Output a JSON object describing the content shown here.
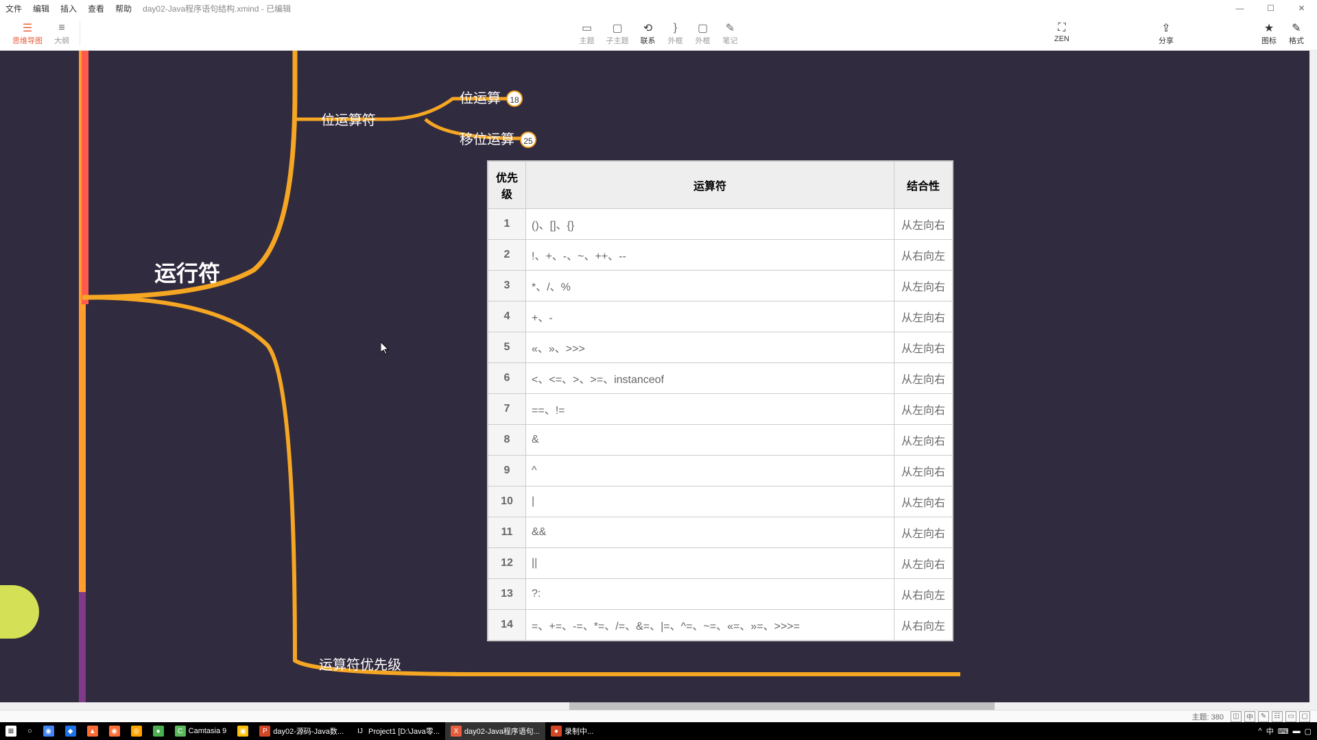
{
  "window": {
    "filename": "day02-Java程序语句结构.xmind - 已编辑",
    "menu": {
      "file": "文件",
      "edit": "编辑",
      "insert": "插入",
      "view": "查看",
      "help": "帮助"
    }
  },
  "toolbar": {
    "mindmap": "思维导图",
    "outline": "大纲",
    "topic": "主题",
    "subtopic": "子主题",
    "relation": "联系",
    "summary": "外框",
    "boundary": "外框",
    "note": "笔记",
    "zen": "ZEN",
    "share": "分享",
    "icon": "图标",
    "format": "格式"
  },
  "mindmap": {
    "title": "运行符",
    "bit_operator": "位运算符",
    "bit_op": "位运算",
    "shift_op": "移位运算",
    "priority": "运算符优先级",
    "badge18": "18",
    "badge25": "25"
  },
  "chart_data": {
    "type": "table",
    "title": "运算符优先级",
    "columns": [
      "优先级",
      "运算符",
      "结合性"
    ],
    "rows": [
      {
        "priority": "1",
        "ops": "()、[]、{}",
        "assoc": "从左向右"
      },
      {
        "priority": "2",
        "ops": "!、+、-、~、++、--",
        "assoc": "从右向左"
      },
      {
        "priority": "3",
        "ops": "*、/、%",
        "assoc": "从左向右"
      },
      {
        "priority": "4",
        "ops": "+、-",
        "assoc": "从左向右"
      },
      {
        "priority": "5",
        "ops": "«、»、>>>",
        "assoc": "从左向右"
      },
      {
        "priority": "6",
        "ops": "<、<=、>、>=、instanceof",
        "assoc": "从左向右"
      },
      {
        "priority": "7",
        "ops": "==、!=",
        "assoc": "从左向右"
      },
      {
        "priority": "8",
        "ops": "&",
        "assoc": "从左向右"
      },
      {
        "priority": "9",
        "ops": "^",
        "assoc": "从左向右"
      },
      {
        "priority": "10",
        "ops": "|",
        "assoc": "从左向右"
      },
      {
        "priority": "11",
        "ops": "&&",
        "assoc": "从左向右"
      },
      {
        "priority": "12",
        "ops": "||",
        "assoc": "从左向右"
      },
      {
        "priority": "13",
        "ops": "?:",
        "assoc": "从右向左"
      },
      {
        "priority": "14",
        "ops": "=、+=、-=、*=、/=、&=、|=、^=、~=、«=、»=、>>>=",
        "assoc": "从右向左"
      }
    ]
  },
  "status": {
    "topic_count": "主题: 380"
  },
  "taskbar": {
    "camtasia": "Camtasia 9",
    "ppt": "day02-源码-Java数...",
    "idea": "Project1 [D:\\Java零...",
    "xmind": "day02-Java程序语句...",
    "rec": "录制中..."
  }
}
